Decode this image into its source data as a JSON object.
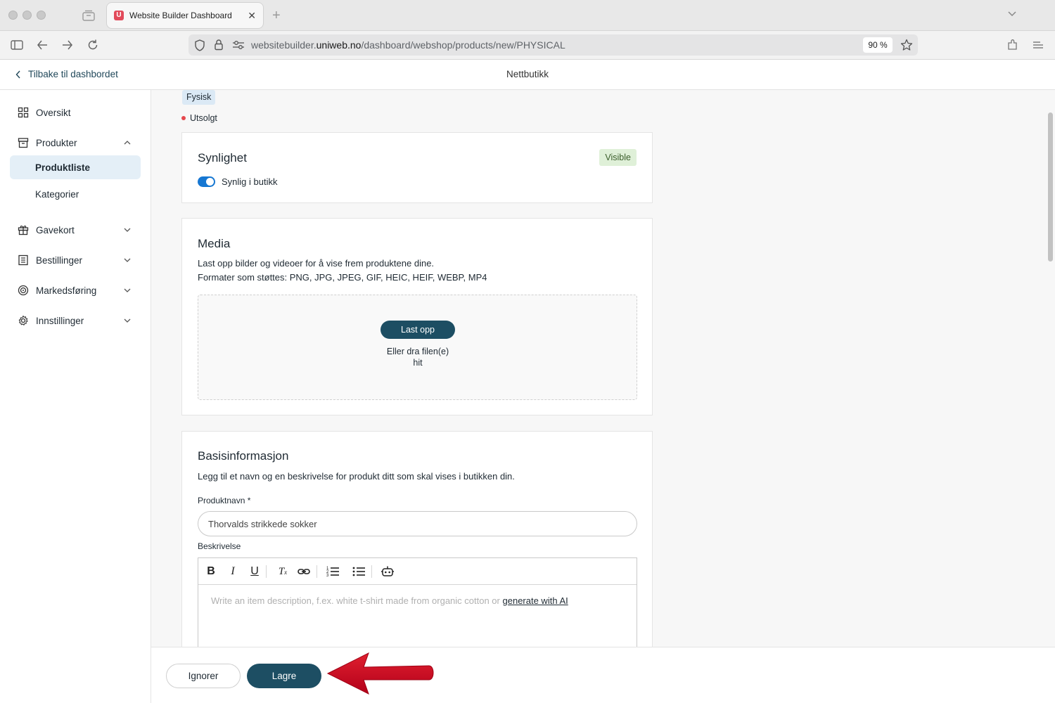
{
  "browser": {
    "tab_title": "Website Builder Dashboard",
    "tab_favicon": "U",
    "url_prefix": "websitebuilder.",
    "url_domain": "uniweb.no",
    "url_path": "/dashboard/webshop/products/new/PHYSICAL",
    "zoom": "90 %"
  },
  "header": {
    "back_label": "Tilbake til dashbordet",
    "title": "Nettbutikk"
  },
  "sidebar": {
    "items": [
      {
        "label": "Oversikt",
        "icon": "grid-icon"
      },
      {
        "label": "Produkter",
        "icon": "box-icon",
        "expanded": true
      },
      {
        "label": "Produktliste",
        "active": true
      },
      {
        "label": "Kategorier"
      },
      {
        "label": "Gavekort",
        "icon": "gift-icon"
      },
      {
        "label": "Bestillinger",
        "icon": "list-icon"
      },
      {
        "label": "Markedsføring",
        "icon": "target-icon"
      },
      {
        "label": "Innstillinger",
        "icon": "gear-icon"
      }
    ]
  },
  "product": {
    "type_chip": "Fysisk",
    "status": "Utsolgt",
    "status_color": "#e5484d"
  },
  "visibility": {
    "title": "Synlighet",
    "badge": "Visible",
    "toggle_label": "Synlig i butikk",
    "toggle_on": true
  },
  "media": {
    "title": "Media",
    "description": "Last opp bilder og videoer for å vise frem produktene dine.",
    "formats": "Formater som støttes: PNG, JPG, JPEG, GIF, HEIC, HEIF, WEBP, MP4",
    "upload_label": "Last opp",
    "drop_hint_1": "Eller dra filen(e)",
    "drop_hint_2": "hit"
  },
  "basic": {
    "title": "Basisinformasjon",
    "description": "Legg til et navn og en beskrivelse for produkt ditt som skal vises i butikken din.",
    "name_label": "Produktnavn *",
    "name_value": "Thorvalds strikkede sokker",
    "desc_label": "Beskrivelse",
    "desc_placeholder": "Write an item description, f.ex. white t-shirt made from organic cotton or",
    "ai_link": "generate with AI"
  },
  "footer": {
    "ignore_label": "Ignorer",
    "save_label": "Lagre"
  },
  "colors": {
    "primary": "#1d4e63",
    "toggle": "#1677d2",
    "annotation_arrow": "#d0021b"
  }
}
